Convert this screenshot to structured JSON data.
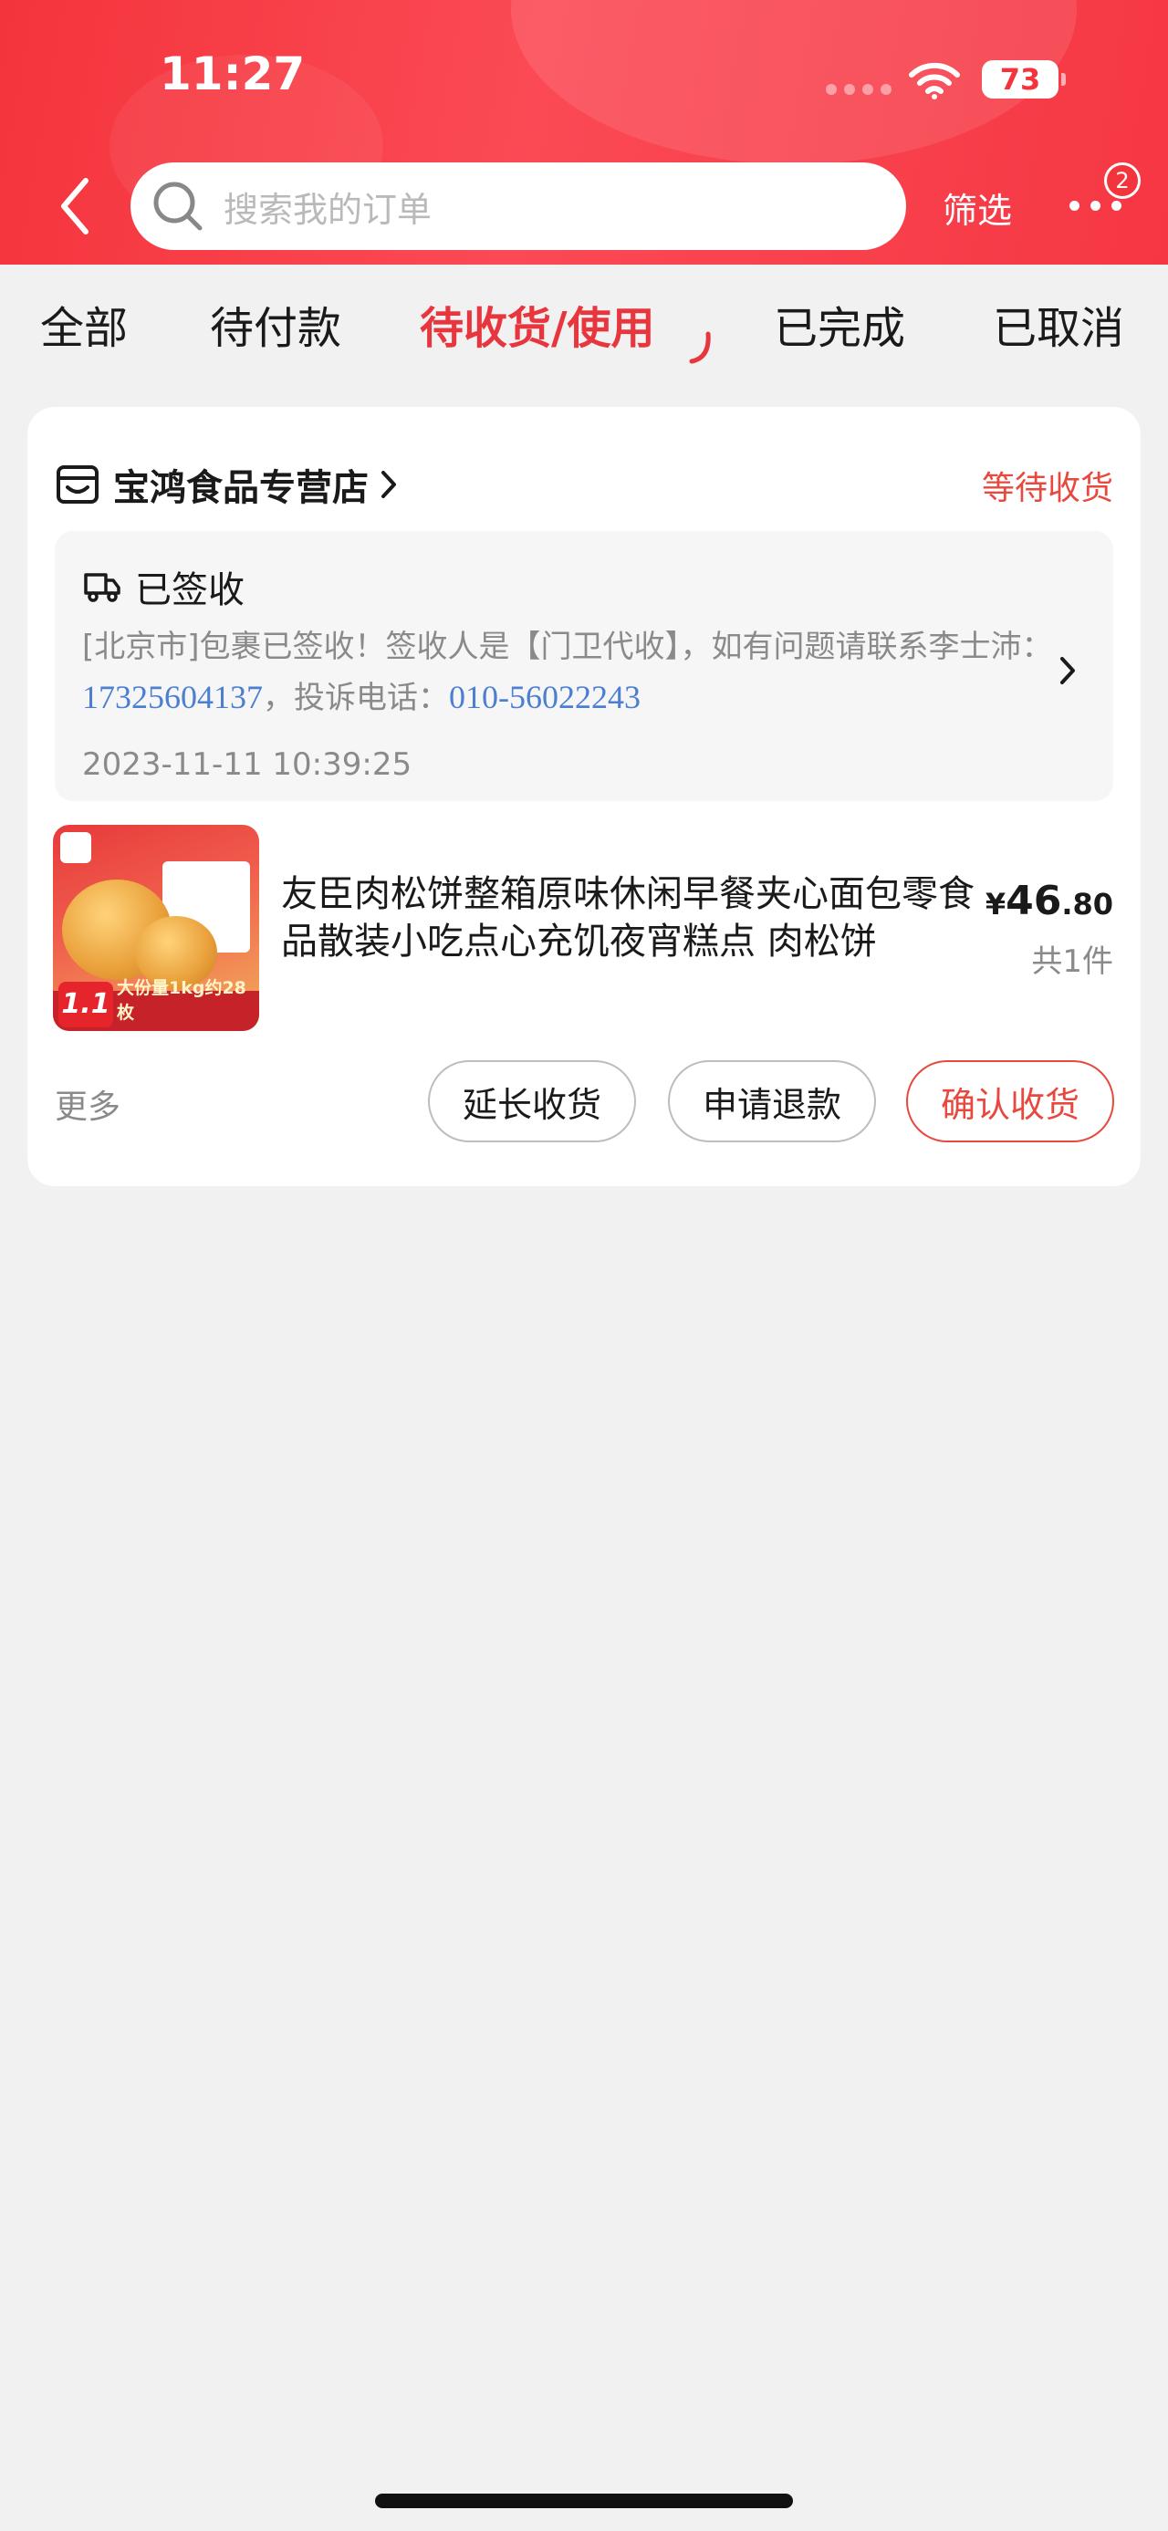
{
  "status_bar": {
    "time": "11:27",
    "battery": "73"
  },
  "header": {
    "search_placeholder": "搜索我的订单",
    "filter_label": "筛选",
    "message_count": "2"
  },
  "tabs": [
    {
      "label": "全部",
      "active": false
    },
    {
      "label": "待付款",
      "active": false
    },
    {
      "label": "待收货/使用",
      "active": true
    },
    {
      "label": "已完成",
      "active": false
    },
    {
      "label": "已取消",
      "active": false
    }
  ],
  "order": {
    "store_name": "宝鸿食品专营店",
    "status": "等待收货",
    "logistics": {
      "title": "已签收",
      "desc_prefix": "[北京市]包裹已签收！签收人是【门卫代收】，如有问题请联系李士沛：",
      "contact_phone": "17325604137",
      "desc_middle": "，投诉电话：",
      "complaint_phone": "010-56022243",
      "time": "2023-11-11 10:39:25"
    },
    "product": {
      "title": "友臣肉松饼整箱原味休闲早餐夹心面包零食品散装小吃点心充饥夜宵糕点 肉松饼",
      "price_currency": "¥",
      "price_integer": "46",
      "price_decimal": ".80",
      "quantity": "共1件",
      "thumb_label": "大份量1kg约28枚",
      "thumb_badge": "1.1"
    },
    "more_label": "更多",
    "buttons": {
      "extend": "延长收货",
      "refund": "申请退款",
      "confirm": "确认收货"
    }
  },
  "colors": {
    "brand_red": "#f4343c",
    "accent_red": "#e8493f",
    "link_blue": "#4c7fd1"
  }
}
